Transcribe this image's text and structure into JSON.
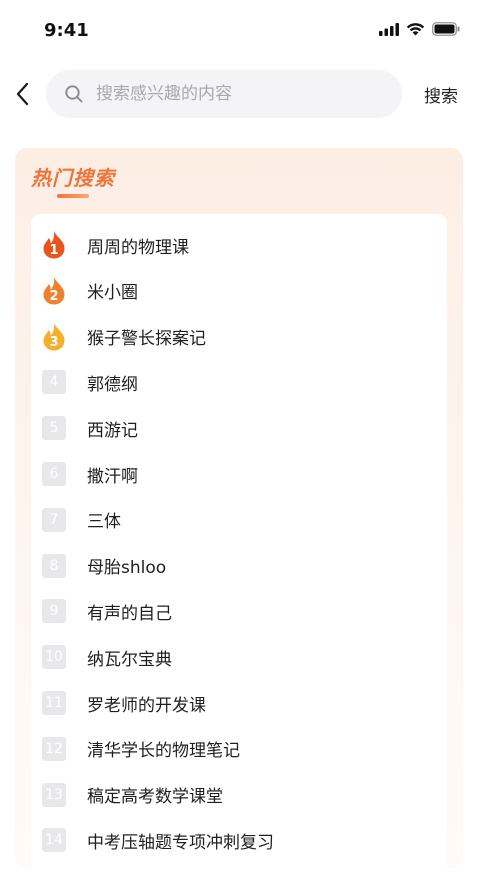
{
  "status": {
    "time": "9:41"
  },
  "search": {
    "placeholder": "搜索感兴趣的内容",
    "button": "搜索"
  },
  "hot": {
    "title": "热门搜索",
    "items": [
      {
        "rank": "1",
        "label": "周周的物理课",
        "flame_color": "#e8541c"
      },
      {
        "rank": "2",
        "label": "米小圈",
        "flame_color": "#f0802e"
      },
      {
        "rank": "3",
        "label": "猴子警长探案记",
        "flame_color": "#f6ae2c"
      },
      {
        "rank": "4",
        "label": "郭德纲"
      },
      {
        "rank": "5",
        "label": "西游记"
      },
      {
        "rank": "6",
        "label": "撒汗啊"
      },
      {
        "rank": "7",
        "label": "三体"
      },
      {
        "rank": "8",
        "label": "母胎shloo"
      },
      {
        "rank": "9",
        "label": "有声的自己"
      },
      {
        "rank": "10",
        "label": "纳瓦尔宝典"
      },
      {
        "rank": "11",
        "label": "罗老师的开发课"
      },
      {
        "rank": "12",
        "label": "清华学长的物理笔记"
      },
      {
        "rank": "13",
        "label": "稿定高考数学课堂"
      },
      {
        "rank": "14",
        "label": "中考压轴题专项冲刺复习"
      }
    ]
  }
}
